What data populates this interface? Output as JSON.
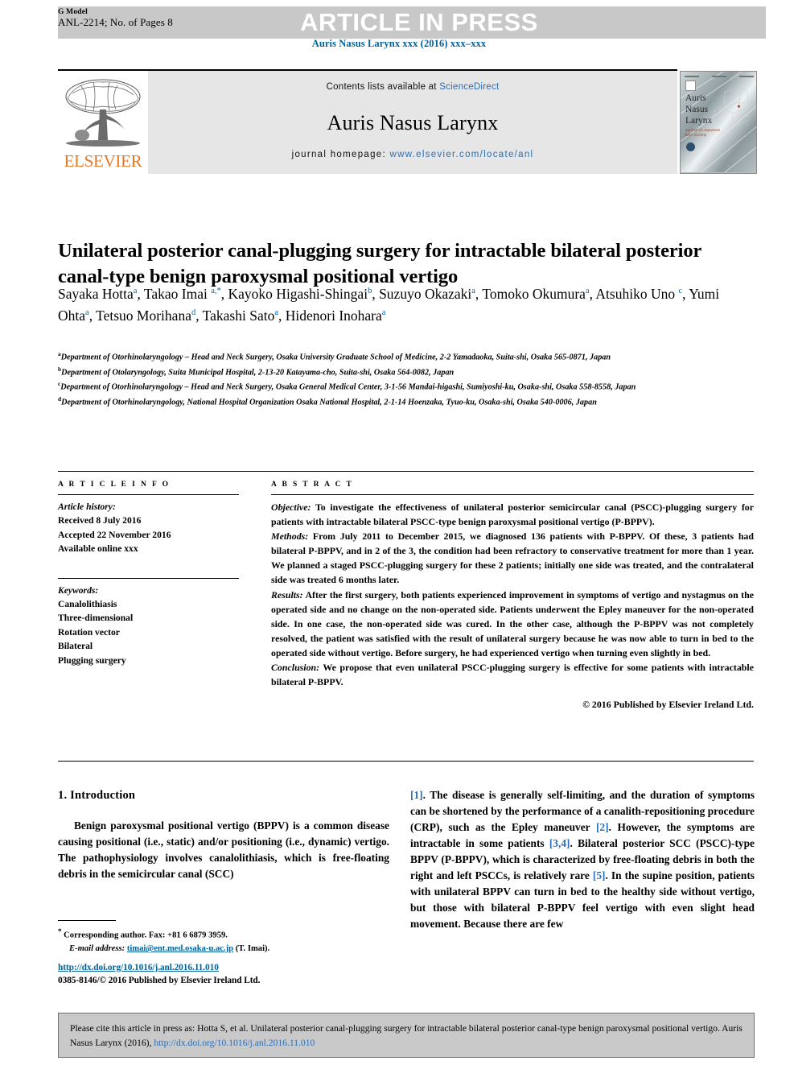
{
  "header": {
    "g_model_label": "G Model",
    "g_model_id": "ANL-2214; No. of Pages 8",
    "press_banner": "ARTICLE IN PRESS",
    "journal_reference": "Auris Nasus Larynx xxx (2016) xxx–xxx"
  },
  "masthead": {
    "contents_prefix": "Contents lists available at ",
    "sciencedirect": "ScienceDirect",
    "journal_title": "Auris Nasus Larynx",
    "homepage_prefix": "journal homepage: ",
    "homepage_url": "www.elsevier.com/locate/anl",
    "publisher": "ELSEVIER",
    "cover_title_lines": [
      "Auris",
      "Nasus",
      "Larynx"
    ],
    "cover_subtitle": "Journal of Japanese\nENT Society"
  },
  "article": {
    "title": "Unilateral posterior canal-plugging surgery for intractable bilateral posterior canal-type benign paroxysmal positional vertigo",
    "authors": [
      {
        "name": "Sayaka Hotta",
        "marks": "a",
        "sep": ", "
      },
      {
        "name": "Takao Imai ",
        "marks": "a,*",
        "sep": ", "
      },
      {
        "name": "Kayoko Higashi-Shingai",
        "marks": "b",
        "sep": ", "
      },
      {
        "name": "Suzuyo Okazaki",
        "marks": "a",
        "sep": ", "
      },
      {
        "name": "Tomoko Okumura",
        "marks": "a",
        "sep": ", "
      },
      {
        "name": "Atsuhiko Uno ",
        "marks": "c",
        "sep": ", "
      },
      {
        "name": "Yumi Ohta",
        "marks": "a",
        "sep": ", "
      },
      {
        "name": "Tetsuo Morihana",
        "marks": "d",
        "sep": ", "
      },
      {
        "name": "Takashi Sato",
        "marks": "a",
        "sep": ", "
      },
      {
        "name": "Hidenori Inohara",
        "marks": "a",
        "sep": ""
      }
    ],
    "affiliations": [
      {
        "mark": "a",
        "text": "Department of Otorhinolaryngology – Head and Neck Surgery, Osaka University Graduate School of Medicine, 2-2 Yamadaoka, Suita-shi, Osaka 565-0871, Japan"
      },
      {
        "mark": "b",
        "text": "Department of Otolaryngology, Suita Municipal Hospital, 2-13-20 Katayama-cho, Suita-shi, Osaka 564-0082, Japan"
      },
      {
        "mark": "c",
        "text": "Department of Otorhinolaryngology – Head and Neck Surgery, Osaka General Medical Center, 3-1-56 Mandai-higashi, Sumiyoshi-ku, Osaka-shi, Osaka 558-8558, Japan"
      },
      {
        "mark": "d",
        "text": "Department of Otorhinolaryngology, National Hospital Organization Osaka National Hospital, 2-1-14 Hoenzaka, Tyuo-ku, Osaka-shi, Osaka 540-0006, Japan"
      }
    ]
  },
  "article_info": {
    "label": "A R T I C L E   I N F O",
    "history_heading": "Article history:",
    "history": [
      "Received 8 July 2016",
      "Accepted 22 November 2016",
      "Available online xxx"
    ],
    "keywords_heading": "Keywords:",
    "keywords": [
      "Canalolithiasis",
      "Three-dimensional",
      "Rotation vector",
      "Bilateral",
      "Plugging surgery"
    ]
  },
  "abstract": {
    "label": "A B S T R A C T",
    "sections": [
      {
        "heading": "Objective:",
        "text": " To investigate the effectiveness of unilateral posterior semicircular canal (PSCC)-plugging surgery for patients with intractable bilateral PSCC-type benign paroxysmal positional vertigo (P-BPPV)."
      },
      {
        "heading": "Methods:",
        "text": " From July 2011 to December 2015, we diagnosed 136 patients with P-BPPV. Of these, 3 patients had bilateral P-BPPV, and in 2 of the 3, the condition had been refractory to conservative treatment for more than 1 year. We planned a staged PSCC-plugging surgery for these 2 patients; initially one side was treated, and the contralateral side was treated 6 months later."
      },
      {
        "heading": "Results:",
        "text": " After the first surgery, both patients experienced improvement in symptoms of vertigo and nystagmus on the operated side and no change on the non-operated side. Patients underwent the Epley maneuver for the non-operated side. In one case, the non-operated side was cured. In the other case, although the P-BPPV was not completely resolved, the patient was satisfied with the result of unilateral surgery because he was now able to turn in bed to the operated side without vertigo. Before surgery, he had experienced vertigo when turning even slightly in bed."
      },
      {
        "heading": "Conclusion:",
        "text": " We propose that even unilateral PSCC-plugging surgery is effective for some patients with intractable bilateral P-BPPV."
      }
    ],
    "copyright": "© 2016 Published by Elsevier Ireland Ltd."
  },
  "body": {
    "intro_heading": "1.  Introduction",
    "left_paragraph": "Benign paroxysmal positional vertigo (BPPV) is a common disease causing positional (i.e., static) and/or positioning (i.e., dynamic) vertigo. The pathophysiology involves canalolithiasis, which is free-floating debris in the semicircular canal (SCC)",
    "right_paragraph_parts": [
      {
        "type": "ref",
        "text": "[1]"
      },
      {
        "type": "text",
        "text": ". The disease is generally self-limiting, and the duration of symptoms can be shortened by the performance of a canalith-repositioning procedure (CRP), such as the Epley maneuver "
      },
      {
        "type": "ref",
        "text": "[2]"
      },
      {
        "type": "text",
        "text": ". However, the symptoms are intractable in some patients "
      },
      {
        "type": "ref",
        "text": "[3,4]"
      },
      {
        "type": "text",
        "text": ". Bilateral posterior SCC (PSCC)-type BPPV (P-BPPV), which is characterized by free-floating debris in both the right and left PSCCs, is relatively rare "
      },
      {
        "type": "ref",
        "text": "[5]"
      },
      {
        "type": "text",
        "text": ". In the supine position, patients with unilateral BPPV can turn in bed to the healthy side without vertigo, but those with bilateral P-BPPV feel vertigo with even slight head movement. Because there are few"
      }
    ]
  },
  "footer": {
    "corresponding_marker": "*",
    "corresponding": " Corresponding author. Fax: +81 6 6879 3959.",
    "email_label": "E-mail address:",
    "email": "timai@ent.med.osaka-u.ac.jp",
    "email_suffix": " (T. Imai).",
    "doi": "http://dx.doi.org/10.1016/j.anl.2016.11.010",
    "issn": "0385-8146/© 2016 Published by Elsevier Ireland Ltd."
  },
  "cite_box": {
    "text_before_link": "Please cite this article in press as: Hotta S, et al. Unilateral posterior canal-plugging surgery for intractable bilateral posterior canal-type benign paroxysmal positional vertigo. Auris Nasus Larynx (2016), ",
    "link": "http://dx.doi.org/10.1016/j.anl.2016.11.010"
  },
  "colors": {
    "link_blue": "#2a6eb5",
    "journal_blue": "#00629b",
    "elsevier_orange": "#e87722",
    "band_gray": "#c8c8c8",
    "masthead_gray": "#e6e6e6",
    "cite_gray": "#c9c9c9"
  }
}
